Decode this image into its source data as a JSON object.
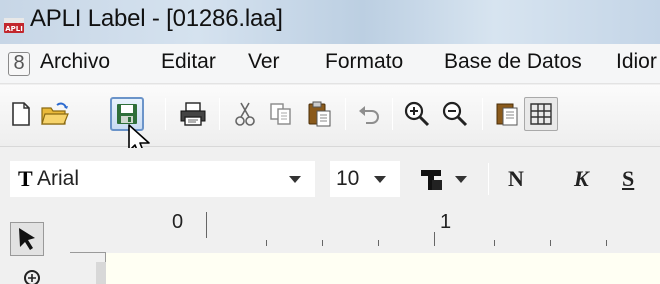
{
  "window": {
    "title": "APLI Label - [01286.laa]"
  },
  "menu": {
    "system_glyph": "8",
    "items": [
      "Archivo",
      "Editar",
      "Ver",
      "Formato",
      "Base de Datos",
      "Idior"
    ]
  },
  "toolbar": {
    "buttons": [
      "new-document",
      "open-folder",
      "save",
      "print",
      "cut",
      "copy",
      "paste",
      "undo",
      "zoom-in",
      "zoom-out",
      "page-setup",
      "grid"
    ]
  },
  "format": {
    "font_icon": "T",
    "font_name": "Arial",
    "font_size": "10",
    "bold_letter": "N",
    "italic_letter": "K",
    "underline_letter": "S"
  },
  "ruler": {
    "labels": [
      "0",
      "1"
    ]
  },
  "colors": {
    "title_bar": "#cbd9e8",
    "save_highlight": "#6b94c9",
    "canvas": "#fffff3"
  }
}
